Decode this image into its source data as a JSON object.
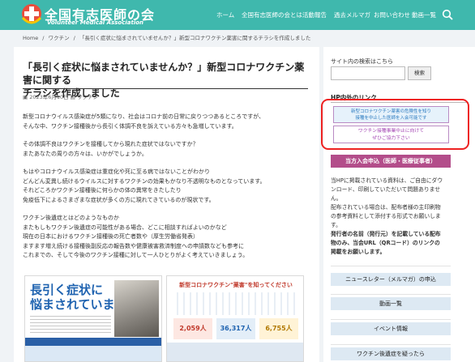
{
  "header": {
    "site_name": "全国有志医師の会",
    "site_sub": "Volunteer Medical Association",
    "nav": [
      "ホーム",
      "全国有志医師の会とは",
      "活動報告",
      "過去メルマガ",
      "お問い合わせ",
      "動画一覧"
    ]
  },
  "breadcrumb": [
    "Home",
    "/",
    "ワクチン",
    "/",
    "「長引く症状に悩まされていませんか？」新型コロナワクチン薬害に関するチラシを作成しました"
  ],
  "article": {
    "title_lines": [
      "「長引く症状に悩まされていませんか？」新型コロナワクチン薬害に関する",
      "チラシを作成しました"
    ],
    "date": "2023年6月10日",
    "category": "ワクチン",
    "paragraphs": [
      [
        "新型コロナウイルス感染症が5類になり、社会はコロナ前の日常に戻りつつあるところですが、",
        "そんな中、ワクチン接種後から長引く体調不良を訴えている方々も急増しています。"
      ],
      [
        "その体調不良はワクチンを接種してから現れた症状ではないですか？",
        "またあなたの周りの方々は、いかがでしょうか。"
      ],
      [
        "もはやコロナウイルス感染症は重症化や死に至る病ではないことがわかり",
        "どんどん変異し続けるウイルスに対するワクチンの効果もかなり不透明なものとなっています。",
        "それどころかワクチン接種後に何らかの体の異常をきたしたり",
        "免疫低下によるさまざまな症状が多くの方に現れてきているのが現状です。"
      ],
      [
        "ワクチン後遺症とはどのようなものか",
        "またもしもワクチン後遺症の可能性がある場合、どこに相談すればよいのかなど",
        "現在の日本におけるワクチン接種後の死亡者数や（厚生労働省発表）",
        "ますます増え続ける接種後副反応の報告数や健康被害救済制度への申請数なども参考に",
        "これまでの、そして今後のワクチン接種に対して一人ひとりがよく考えていきましょう。"
      ]
    ],
    "flyer1": {
      "title_lines": [
        "長引く症状に",
        "悩まされていませんか？"
      ]
    },
    "flyer2": {
      "title": "新型コロナワクチン\"薬害\"を知ってください",
      "stats": [
        "2,059人",
        "36,317人",
        "6,755人"
      ]
    }
  },
  "sidebar": {
    "search_label": "サイト内の検索はこちら",
    "search_button": "検索",
    "hp_title": "HP内外のリンク",
    "banner1_lines": [
      "新型コロナワクチン薬害の危険性を知り",
      "接種を中止した医師を入会可能です"
    ],
    "banner2_lines": [
      "ワクチン接種事業中止に向けて",
      "ぜひご協力下さい"
    ],
    "join_button": "当方入会申込（医師・医療従事者）",
    "text_lines": [
      "当HPに掲載されている資料は、ご自由にダウ",
      "ンロード、印刷していただいて問題ありませ",
      "ん。",
      "配布されている場合は、配布者様の主印刷物",
      "の参考資料として添付する形式でお願いしま",
      "す。",
      "発行者の名前（発行元）を記載している配布",
      "物のみ、当会URL（QRコード）のリンクの",
      "掲載をお願いします。"
    ],
    "buttons": [
      "ニュースレター（メルマガ）の申込",
      "動画一覧",
      "イベント情報",
      "ワクチン後遺症を疑ったら"
    ]
  },
  "colors": {
    "header": "#3fb8ad",
    "accent": "#b34d8a",
    "highlight": "#e22222"
  }
}
